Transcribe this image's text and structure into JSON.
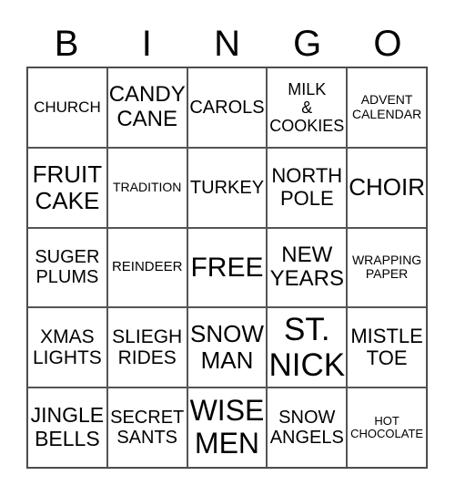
{
  "header": [
    "B",
    "I",
    "N",
    "G",
    "O"
  ],
  "cells": [
    {
      "text": "CHURCH",
      "size": 17
    },
    {
      "text": "CANDY\nCANE",
      "size": 24
    },
    {
      "text": "CAROLS",
      "size": 20
    },
    {
      "text": "MILK\n&\nCOOKIES",
      "size": 18
    },
    {
      "text": "ADVENT\nCALENDAR",
      "size": 14
    },
    {
      "text": "FRUIT\nCAKE",
      "size": 26
    },
    {
      "text": "TRADITION",
      "size": 14
    },
    {
      "text": "TURKEY",
      "size": 20
    },
    {
      "text": "NORTH\nPOLE",
      "size": 22
    },
    {
      "text": "CHOIR",
      "size": 26
    },
    {
      "text": "SUGER\nPLUMS",
      "size": 20
    },
    {
      "text": "REINDEER",
      "size": 15
    },
    {
      "text": "FREE",
      "size": 30
    },
    {
      "text": "NEW\nYEARS",
      "size": 24
    },
    {
      "text": "WRAPPING\nPAPER",
      "size": 14
    },
    {
      "text": "XMAS\nLIGHTS",
      "size": 21
    },
    {
      "text": "SLIEGH\nRIDES",
      "size": 21
    },
    {
      "text": "SNOW\nMAN",
      "size": 26
    },
    {
      "text": "ST.\nNICK",
      "size": 35
    },
    {
      "text": "MISTLE\nTOE",
      "size": 22
    },
    {
      "text": "JINGLE\nBELLS",
      "size": 23
    },
    {
      "text": "SECRET\nSANTS",
      "size": 20
    },
    {
      "text": "WISE\nMEN",
      "size": 32
    },
    {
      "text": "SNOW\nANGELS",
      "size": 20
    },
    {
      "text": "HOT\nCHOCOLATE",
      "size": 13
    }
  ]
}
